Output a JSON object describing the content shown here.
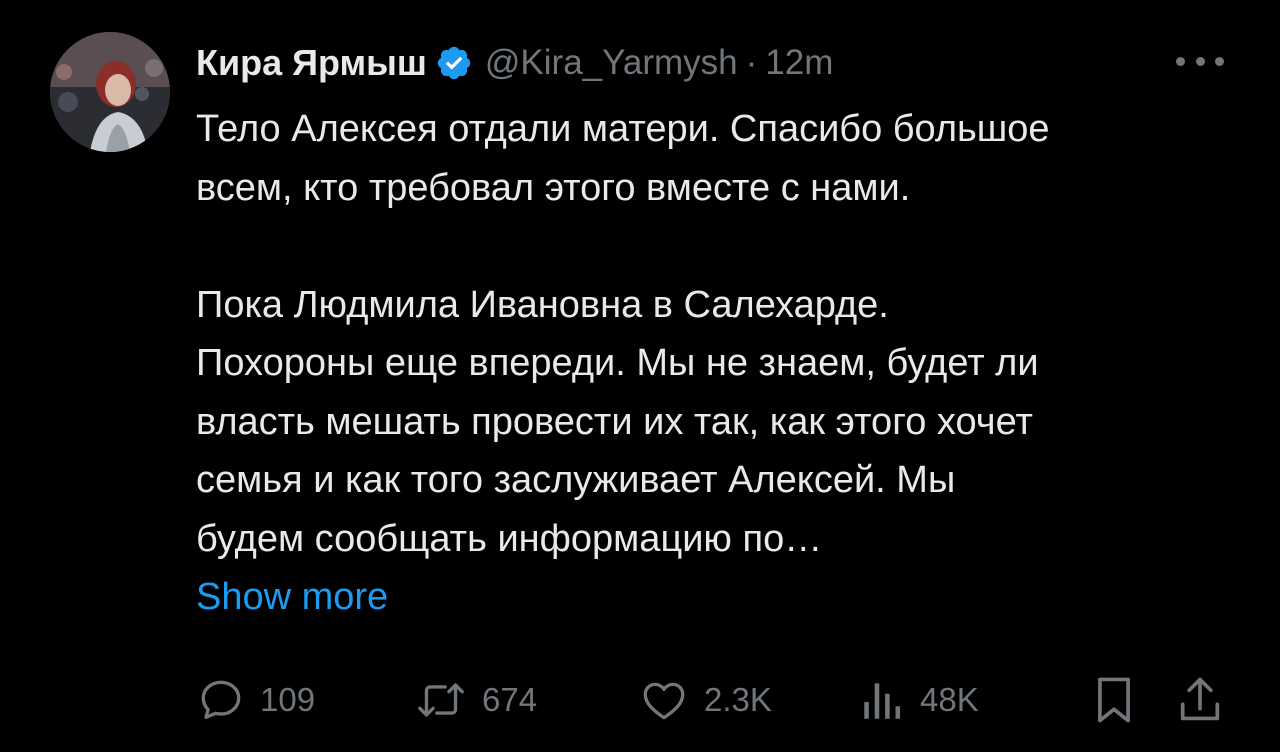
{
  "tweet": {
    "author": {
      "display_name": "Кира Ярмыш",
      "handle": "@Kira_Yarmysh",
      "verified": true
    },
    "separator": "·",
    "time": "12m",
    "text_lines_p1": [
      "Тело Алексея отдали матери. Спасибо большое",
      "всем, кто требовал этого вместе с нами."
    ],
    "text_lines_p2": [
      "Пока Людмила Ивановна в Салехарде.",
      "Похороны еще впереди. Мы не знаем, будет ли",
      "власть мешать провести их так, как этого хочет",
      "семья и как того заслуживает Алексей. Мы",
      "будем сообщать информацию по…"
    ],
    "show_more_label": "Show more",
    "actions": {
      "replies": "109",
      "reposts": "674",
      "likes": "2.3K",
      "views": "48K"
    }
  },
  "icons": {
    "verified": "verified-badge-icon",
    "more": "more-dots-icon",
    "reply": "reply-bubble-icon",
    "repost": "repost-arrows-icon",
    "like": "heart-icon",
    "views": "bar-chart-icon",
    "bookmark": "bookmark-icon",
    "share": "share-upload-icon"
  },
  "colors": {
    "background": "#000000",
    "text": "#e7e9ea",
    "muted": "#71767b",
    "accent": "#1d9bf0"
  }
}
